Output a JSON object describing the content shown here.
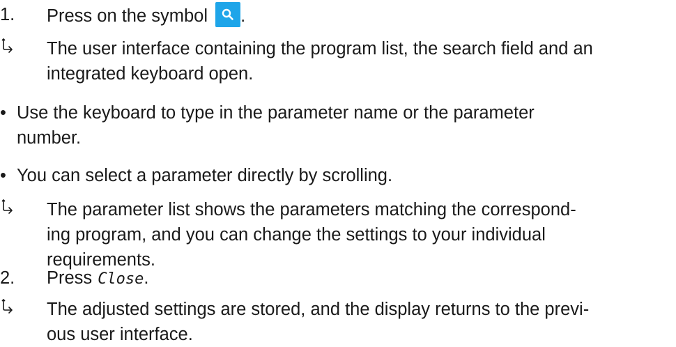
{
  "step1": {
    "number": "1.",
    "text": "Press on the symbol ",
    "after_icon": ".",
    "icon": "search-icon",
    "icon_color": "#1ea5e9"
  },
  "result1": {
    "icon": "result-arrow-icon",
    "line1": "The user interface containing the program list, the search field and an",
    "line2": "integrated keyboard open."
  },
  "bullet1": {
    "marker": "•",
    "line1": " Use the keyboard to type in the parameter name or the parameter",
    "line2": "number."
  },
  "bullet2": {
    "marker": "•",
    "line1": "You can select a parameter directly by scrolling."
  },
  "result2": {
    "icon": "result-arrow-icon",
    "line1": "The parameter list shows the parameters matching the correspond-",
    "line2": "ing program, and you can change the settings to your individual",
    "line3": "requirements."
  },
  "step2": {
    "number": "2.",
    "text": "Press",
    "code": "Close",
    "after": "."
  },
  "result3": {
    "icon": "result-arrow-icon",
    "line1": "The adjusted settings are stored, and the display returns to the previ-",
    "line2": "ous user interface."
  }
}
